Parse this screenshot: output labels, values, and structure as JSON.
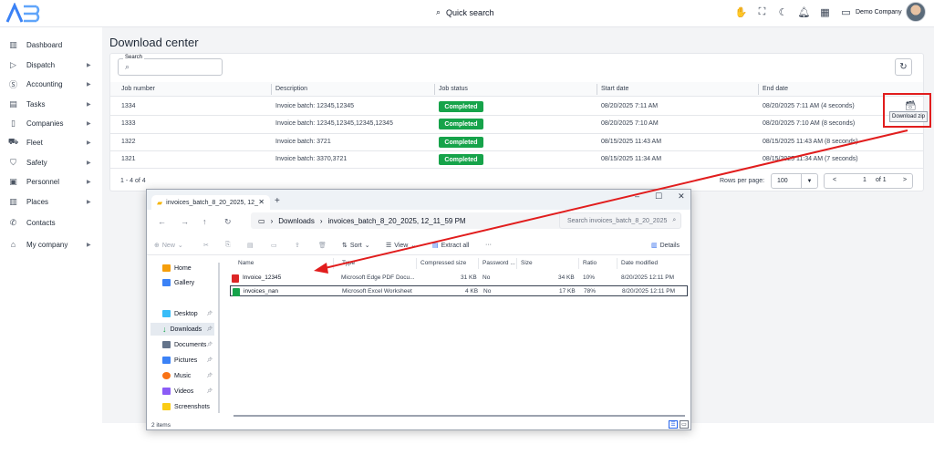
{
  "topbar": {
    "search_label": "Quick search",
    "company": "Demo Company",
    "icons": [
      "hand-icon",
      "expand-icon",
      "moon-icon",
      "bell-icon",
      "grid-icon",
      "display-icon"
    ]
  },
  "sidebar": {
    "items": [
      {
        "label": "Dashboard",
        "icon": "chart-icon",
        "chevron": false
      },
      {
        "label": "Dispatch",
        "icon": "send-icon",
        "chevron": true
      },
      {
        "label": "Accounting",
        "icon": "dollar-icon",
        "chevron": true
      },
      {
        "label": "Tasks",
        "icon": "clipboard-icon",
        "chevron": true
      },
      {
        "label": "Companies",
        "icon": "building-icon",
        "chevron": true
      },
      {
        "label": "Fleet",
        "icon": "truck-icon",
        "chevron": true
      },
      {
        "label": "Safety",
        "icon": "shield-icon",
        "chevron": true
      },
      {
        "label": "Personnel",
        "icon": "id-card-icon",
        "chevron": true
      },
      {
        "label": "Places",
        "icon": "map-icon",
        "chevron": true
      },
      {
        "label": "Contacts",
        "icon": "phone-icon",
        "chevron": false
      },
      {
        "label": "My company",
        "icon": "home-icon",
        "chevron": true
      }
    ]
  },
  "page": {
    "title": "Download center",
    "search_label": "Search",
    "columns": [
      "Job number",
      "Description",
      "Job status",
      "Start date",
      "End date"
    ],
    "rows": [
      {
        "job": "1334",
        "description": "Invoice batch: 12345,12345",
        "status": "Completed",
        "start": "08/20/2025 7:11 AM",
        "end": "08/20/2025 7:11 AM (4 seconds)"
      },
      {
        "job": "1333",
        "description": "Invoice batch: 12345,12345,12345,12345",
        "status": "Completed",
        "start": "08/20/2025 7:10 AM",
        "end": "08/20/2025 7:10 AM (8 seconds)"
      },
      {
        "job": "1322",
        "description": "Invoice batch: 3721",
        "status": "Completed",
        "start": "08/15/2025 11:43 AM",
        "end": "08/15/2025 11:43 AM (8 seconds)"
      },
      {
        "job": "1321",
        "description": "Invoice batch: 3370,3721",
        "status": "Completed",
        "start": "08/15/2025 11:34 AM",
        "end": "08/15/2025 11:34 AM (7 seconds)"
      }
    ],
    "count": "1 - 4 of 4",
    "rows_per_page_label": "Rows per page:",
    "rows_per_page": "100",
    "page_number": "1",
    "page_of": "of 1",
    "tooltip": "Download zip",
    "accent_green": "#16a34a",
    "highlight_red": "#e11d1d"
  },
  "explorer": {
    "tab_title": "invoices_batch_8_20_2025, 12_",
    "path_root": "Downloads",
    "path_folder": "invoices_batch_8_20_2025, 12_11_59 PM",
    "search_placeholder": "Search invoices_batch_8_20_2025",
    "toolbar": {
      "new": "New",
      "sort": "Sort",
      "view": "View",
      "extract": "Extract all",
      "more": "···",
      "details": "Details"
    },
    "nav": [
      {
        "label": "Home",
        "color": "#f59e0b",
        "pin": false
      },
      {
        "label": "Gallery",
        "color": "#3b82f6",
        "pin": false
      },
      {
        "label": "Desktop",
        "color": "#38bdf8",
        "pin": true
      },
      {
        "label": "Downloads",
        "color": "#16a34a",
        "pin": true
      },
      {
        "label": "Documents",
        "color": "#64748b",
        "pin": true
      },
      {
        "label": "Pictures",
        "color": "#3b82f6",
        "pin": true
      },
      {
        "label": "Music",
        "color": "#f97316",
        "pin": true
      },
      {
        "label": "Videos",
        "color": "#8b5cf6",
        "pin": true
      },
      {
        "label": "Screenshots",
        "color": "#facc15",
        "pin": false
      }
    ],
    "headers": [
      "Name",
      "Type",
      "Compressed size",
      "Password ...",
      "Size",
      "Ratio",
      "Date modified"
    ],
    "files": [
      {
        "name": "Invoice_12345",
        "type": "Microsoft Edge PDF Docu...",
        "compressed": "31 KB",
        "password": "No",
        "size": "34 KB",
        "ratio": "10%",
        "date": "8/20/2025 12:11 PM",
        "color": "#dc2626"
      },
      {
        "name": "invoices_nan",
        "type": "Microsoft Excel Worksheet",
        "compressed": "4 KB",
        "password": "No",
        "size": "17 KB",
        "ratio": "78%",
        "date": "8/20/2025 12:11 PM",
        "color": "#16a34a"
      }
    ],
    "status": "2 items"
  }
}
